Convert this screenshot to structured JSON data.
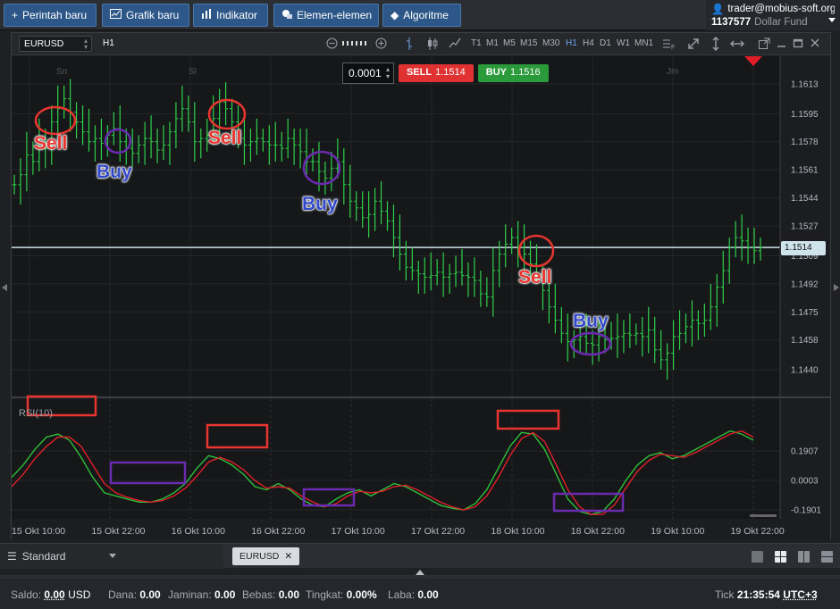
{
  "toolbar": {
    "new_order": "Perintah baru",
    "new_chart": "Grafik baru",
    "indicator": "Indikator",
    "elements": "Elemen-elemen",
    "algorithm": "Algoritme"
  },
  "account": {
    "user": "trader@mobius-soft.org",
    "number": "1137577",
    "fund": "Dollar Fund"
  },
  "chart": {
    "symbol": "EURUSD",
    "timeframe": "H1",
    "timeframes": [
      "T1",
      "M1",
      "M5",
      "M15",
      "M30",
      "H1",
      "H4",
      "D1",
      "W1",
      "MN1"
    ],
    "active_timeframe": "H1",
    "lot": "0.0001",
    "sell_label": "SELL",
    "sell_price": "1.1514",
    "buy_label": "BUY",
    "buy_price": "1.1516",
    "current_price": "1.1514",
    "day_labels": [
      "Sn",
      "Sl",
      "Jm"
    ],
    "rsi_label": "RSI(10)",
    "annotations": {
      "sell1": "Sell",
      "sell2": "Sell",
      "sell3": "Sell",
      "buy1": "Buy",
      "buy2": "Buy",
      "buy3": "Buy"
    }
  },
  "chart_data": {
    "type": "line",
    "price_axis_ticks": [
      "1.1613",
      "1.1595",
      "1.1578",
      "1.1561",
      "1.1544",
      "1.1527",
      "1.1509",
      "1.1492",
      "1.1475",
      "1.1458",
      "1.1440"
    ],
    "rsi_axis_ticks": [
      "0.1907",
      "0.0003",
      "-0.1901"
    ],
    "x_labels": [
      "15 Okt 10:00",
      "15 Okt 22:00",
      "16 Okt 10:00",
      "16 Okt 22:00",
      "17 Okt 10:00",
      "17 Okt 22:00",
      "18 Okt 10:00",
      "18 Okt 22:00",
      "19 Okt 10:00",
      "19 Okt 22:00"
    ],
    "bars": [
      1.1552,
      1.1558,
      1.157,
      1.1566,
      1.158,
      1.1574,
      1.159,
      1.1598,
      1.1604,
      1.1596,
      1.159,
      1.1584,
      1.1578,
      1.158,
      1.1577,
      1.1582,
      1.1586,
      1.1578,
      1.1574,
      1.1571,
      1.1576,
      1.158,
      1.1578,
      1.1573,
      1.1576,
      1.1584,
      1.1592,
      1.1598,
      1.159,
      1.1578,
      1.158,
      1.1582,
      1.1592,
      1.1602,
      1.1598,
      1.159,
      1.158,
      1.1576,
      1.1578,
      1.158,
      1.1578,
      1.1576,
      1.1576,
      1.1574,
      1.158,
      1.1576,
      1.1572,
      1.1566,
      1.1566,
      1.156,
      1.1556,
      1.1562,
      1.1566,
      1.1552,
      1.1542,
      1.1538,
      1.1532,
      1.1534,
      1.1542,
      1.1536,
      1.153,
      1.152,
      1.151,
      1.1502,
      1.15,
      1.1498,
      1.1496,
      1.1497,
      1.1499,
      1.1496,
      1.1498,
      1.1499,
      1.1497,
      1.1496,
      1.1494,
      1.1486,
      1.1484,
      1.15,
      1.151,
      1.1516,
      1.152,
      1.1514,
      1.151,
      1.1504,
      1.1498,
      1.1488,
      1.1478,
      1.147,
      1.1462,
      1.1457,
      1.1458,
      1.146,
      1.1456,
      1.1455,
      1.146,
      1.1458,
      1.1459,
      1.146,
      1.1462,
      1.1461,
      1.1462,
      1.146,
      1.1464,
      1.1452,
      1.1446,
      1.145,
      1.146,
      1.1462,
      1.1466,
      1.147,
      1.1468,
      1.147,
      1.1478,
      1.149,
      1.15,
      1.1514,
      1.152,
      1.1518,
      1.1514,
      1.1512,
      1.1514
    ],
    "rsi_green": [
      0.02,
      0.1,
      0.2,
      0.28,
      0.3,
      0.26,
      0.15,
      0.02,
      -0.08,
      -0.1,
      -0.12,
      -0.14,
      -0.14,
      -0.12,
      -0.08,
      -0.02,
      0.08,
      0.16,
      0.14,
      0.1,
      0.04,
      -0.04,
      -0.06,
      -0.02,
      -0.06,
      -0.12,
      -0.16,
      -0.17,
      -0.12,
      -0.08,
      -0.06,
      -0.1,
      -0.06,
      -0.02,
      -0.04,
      -0.08,
      -0.12,
      -0.16,
      -0.18,
      -0.19,
      -0.15,
      -0.06,
      0.08,
      0.22,
      0.31,
      0.3,
      0.2,
      0.04,
      -0.12,
      -0.2,
      -0.22,
      -0.2,
      -0.12,
      0.0,
      0.1,
      0.16,
      0.18,
      0.14,
      0.16,
      0.2,
      0.24,
      0.28,
      0.32,
      0.3,
      0.26
    ],
    "rsi_red": [
      -0.04,
      0.04,
      0.14,
      0.22,
      0.28,
      0.28,
      0.22,
      0.1,
      -0.02,
      -0.08,
      -0.11,
      -0.13,
      -0.14,
      -0.13,
      -0.1,
      -0.05,
      0.03,
      0.12,
      0.15,
      0.12,
      0.07,
      0.0,
      -0.05,
      -0.04,
      -0.05,
      -0.1,
      -0.14,
      -0.17,
      -0.15,
      -0.1,
      -0.07,
      -0.08,
      -0.07,
      -0.04,
      -0.03,
      -0.06,
      -0.1,
      -0.14,
      -0.17,
      -0.19,
      -0.17,
      -0.1,
      0.02,
      0.16,
      0.27,
      0.31,
      0.25,
      0.1,
      -0.06,
      -0.17,
      -0.22,
      -0.22,
      -0.16,
      -0.05,
      0.06,
      0.13,
      0.17,
      0.16,
      0.15,
      0.18,
      0.22,
      0.26,
      0.3,
      0.32,
      0.28
    ]
  },
  "tabs": {
    "template": "Standard",
    "chart_tab": "EURUSD"
  },
  "status": {
    "saldo_label": "Saldo:",
    "saldo": "0.00",
    "currency": "USD",
    "dana_label": "Dana:",
    "dana": "0.00",
    "jaminan_label": "Jaminan:",
    "jaminan": "0.00",
    "bebas_label": "Bebas:",
    "bebas": "0.00",
    "tingkat_label": "Tingkat:",
    "tingkat": "0.00%",
    "laba_label": "Laba:",
    "laba": "0.00",
    "tick_label": "Tick",
    "time": "21:35:54",
    "tz": "UTC+3"
  },
  "colors": {
    "sell": "#e03232",
    "buy": "#2a9a3a",
    "bar": "#2fd04a",
    "rsi_green": "#2fbf3a",
    "rsi_red": "#e0202a",
    "annotation_sell": "#e8352f",
    "annotation_buy": "#6a2bb0"
  }
}
